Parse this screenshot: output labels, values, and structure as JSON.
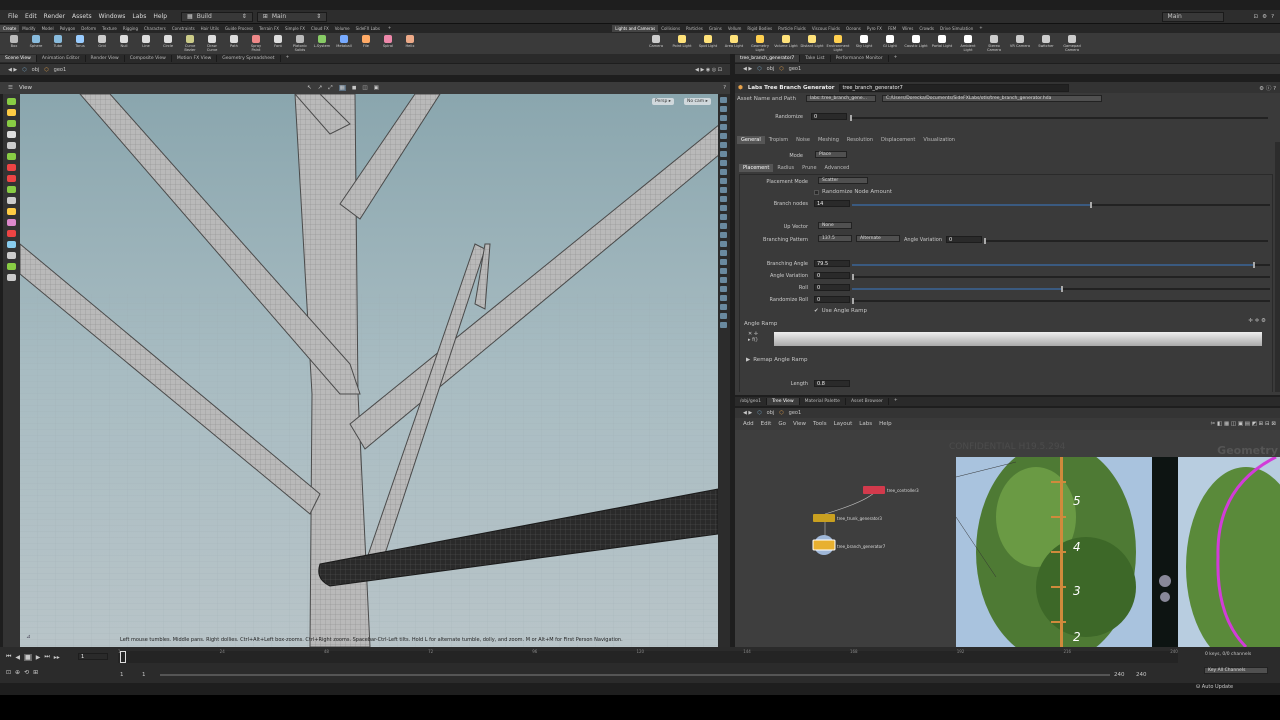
{
  "menu": [
    "File",
    "Edit",
    "Render",
    "Assets",
    "Windows",
    "Labs",
    "Help"
  ],
  "desktop_build": "Build",
  "desktop_main": "Main",
  "right_desktop": "Main",
  "shelf_tabs_left": [
    "Create",
    "Modify",
    "Model",
    "Polygon",
    "Deform",
    "Texture",
    "Rigging",
    "Characters",
    "Constraints",
    "Hair Utils",
    "Guide Process",
    "Terrain FX",
    "Simple FX",
    "Cloud FX",
    "Volume",
    "SideFX Labs"
  ],
  "shelf_tabs_right": [
    "Lights and Cameras",
    "Collisions",
    "Particles",
    "Grains",
    "Vellum",
    "Rigid Bodies",
    "Particle Fluids",
    "Viscous Fluids",
    "Oceans",
    "Pyro FX",
    "FEM",
    "Wires",
    "Crowds",
    "Drive Simulation"
  ],
  "shelf_tools_left": [
    "Box",
    "Sphere",
    "Tube",
    "Torus",
    "Grid",
    "Null",
    "Line",
    "Circle",
    "Curve Bezier",
    "Draw Curve",
    "Path",
    "Spray Paint",
    "Font",
    "Platonic Solids",
    "L-System",
    "Metaball",
    "File",
    "Spiral",
    "Helix"
  ],
  "shelf_tools_right": [
    "Camera",
    "Point Light",
    "Spot Light",
    "Area Light",
    "Geometry Light",
    "Volume Light",
    "Distant Light",
    "Environment Light",
    "Sky Light",
    "GI Light",
    "Caustic Light",
    "Portal Light",
    "Ambient Light",
    "Stereo Camera",
    "VR Camera",
    "Switcher",
    "Gamepad Camera"
  ],
  "left_pane_tabs": [
    "Scene View",
    "Animation Editor",
    "Render View",
    "Composite View",
    "Motion FX View",
    "Geometry Spreadsheet"
  ],
  "right_pane_tabs": [
    "tree_branch_generator7",
    "Take List",
    "Performance Monitor"
  ],
  "path_obj": "obj",
  "path_geo": "geo1",
  "view_label": "View",
  "persp_label": "Persp ▸",
  "cam_label": "No cam ▸",
  "viewport_hint": "Left mouse tumbles. Middle pans. Right dollies. Ctrl+Alt+Left box-zooms. Ctrl+Right zooms. Spacebar-Ctrl-Left tilts. Hold L for alternate tumble, dolly, and zoom.    M or Alt+M for First Person Navigation.",
  "param": {
    "node_type": "Labs Tree Branch Generator",
    "node_name": "tree_branch_generator7",
    "asset_label": "Asset Name and Path",
    "asset_name": "labs::tree_branch_gene...",
    "asset_path": "C:/Users/Dorecka/Documents/SideFXLabs/otls/tree_branch_generator.hda",
    "randomize_label": "Randomize",
    "randomize_val": "0",
    "tabs": [
      "General",
      "Tropism",
      "Noise",
      "Meshing",
      "Resolution",
      "Displacement",
      "Visualization"
    ],
    "mode_label": "Mode",
    "mode_val": "Place",
    "subtabs": [
      "Placement",
      "Radius",
      "Prune",
      "Advanced"
    ],
    "placement_mode_label": "Placement Mode",
    "placement_mode_val": "Scatter",
    "randomize_node_amount": "Randomize Node Amount",
    "branch_nodes_label": "Branch nodes",
    "branch_nodes_val": "14",
    "branch_nodes_fill": 0.57,
    "up_vector_label": "Up Vector",
    "up_vector_val": "None",
    "branching_pattern_label": "Branching Pattern",
    "branching_pattern_val": "137.5",
    "alternate_val": "Alternate",
    "angle_variation_label": "Angle Variation",
    "angle_variation_val": "0",
    "branching_angle_label": "Branching Angle",
    "branching_angle_val": "79.5",
    "branching_angle_fill": 0.96,
    "angle_var2_label": "Angle Variation",
    "angle_var2_val": "0",
    "roll_label": "Roll",
    "roll_val": "0",
    "roll_fill": 0.5,
    "randomize_roll_label": "Randomize Roll",
    "randomize_roll_val": "0",
    "use_angle_ramp": "Use Angle Ramp",
    "angle_ramp_label": "Angle Ramp",
    "remap_label": "Remap Angle Ramp",
    "length_label": "Length",
    "length_val": "0.8"
  },
  "net": {
    "tabs": [
      "/obj/geo1",
      "Tree View",
      "Material Palette",
      "Asset Browser"
    ],
    "path_obj": "obj",
    "path_geo": "geo1",
    "menu": [
      "Add",
      "Edit",
      "Go",
      "View",
      "Tools",
      "Layout",
      "Labs",
      "Help"
    ],
    "watermark": "CONFIDENTIAL H19.5.294",
    "context": "Geometry",
    "nodes": [
      "tree_controller3",
      "tree_trunk_generator3",
      "tree_branch_generator7"
    ],
    "ruler": [
      "5",
      "4",
      "3",
      "2"
    ]
  },
  "timeline": {
    "frame": "1",
    "ticks": [
      "1",
      "24",
      "48",
      "72",
      "96",
      "120",
      "144",
      "168",
      "192",
      "216",
      "240"
    ],
    "start": "1",
    "start2": "1",
    "end": "240",
    "end2": "240",
    "keys": "0 keys, 0/0 channels",
    "key_all": "Key All Channels",
    "auto_update": "Auto Update"
  }
}
